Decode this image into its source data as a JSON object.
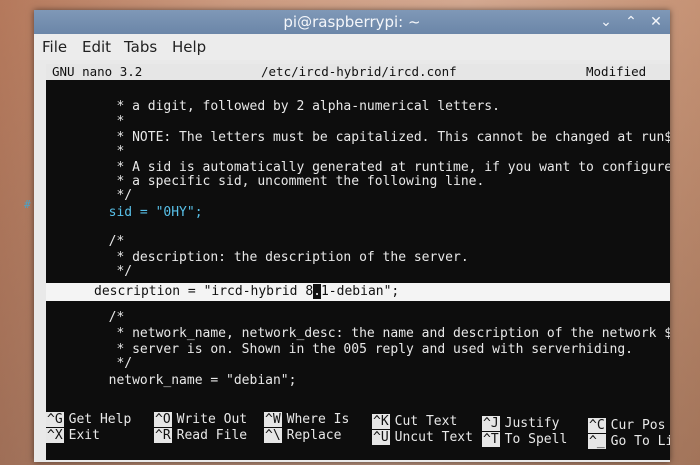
{
  "window": {
    "title": "pi@raspberrypi: ~",
    "controls": {
      "minimize": "⌄",
      "maximize": "⌃",
      "close": "✕"
    }
  },
  "menu": [
    "File",
    "Edit",
    "Tabs",
    "Help"
  ],
  "nano": {
    "version": "GNU nano 3.2",
    "filename": "/etc/ircd-hybrid/ircd.conf",
    "status": "Modified"
  },
  "editor": {
    "lines": [
      "         * a digit, followed by 2 alpha-numerical letters.",
      "         *",
      "         * NOTE: The letters must be capitalized. This cannot be changed at run$",
      "         *",
      "         * A sid is automatically generated at runtime, if you want to configure",
      "         * a specific sid, uncomment the following line.",
      "         */",
      "        sid = \"0HY\";",
      "",
      "        /*",
      "         * description: the description of the server.",
      "         */"
    ],
    "margin_marker": "#",
    "highlight_before": "description = \"ircd-hybrid 8",
    "highlight_cursor": ".",
    "highlight_after": "1-debian\";",
    "lines_after": [
      "",
      "        /*",
      "         * network_name, network_desc: the name and description of the network $",
      "         * server is on. Shown in the 005 reply and used with serverhiding.",
      "         */",
      "        network_name = \"debian\";"
    ]
  },
  "shortcuts": [
    {
      "key": "^G",
      "label": "Get Help"
    },
    {
      "key": "^O",
      "label": "Write Out"
    },
    {
      "key": "^W",
      "label": "Where Is"
    },
    {
      "key": "^K",
      "label": "Cut Text"
    },
    {
      "key": "^J",
      "label": "Justify"
    },
    {
      "key": "^C",
      "label": "Cur Pos"
    },
    {
      "key": "^X",
      "label": "Exit"
    },
    {
      "key": "^R",
      "label": "Read File"
    },
    {
      "key": "^\\",
      "label": "Replace"
    },
    {
      "key": "^U",
      "label": "Uncut Text"
    },
    {
      "key": "^T",
      "label": "To Spell"
    },
    {
      "key": "^_",
      "label": "Go To Line"
    }
  ]
}
